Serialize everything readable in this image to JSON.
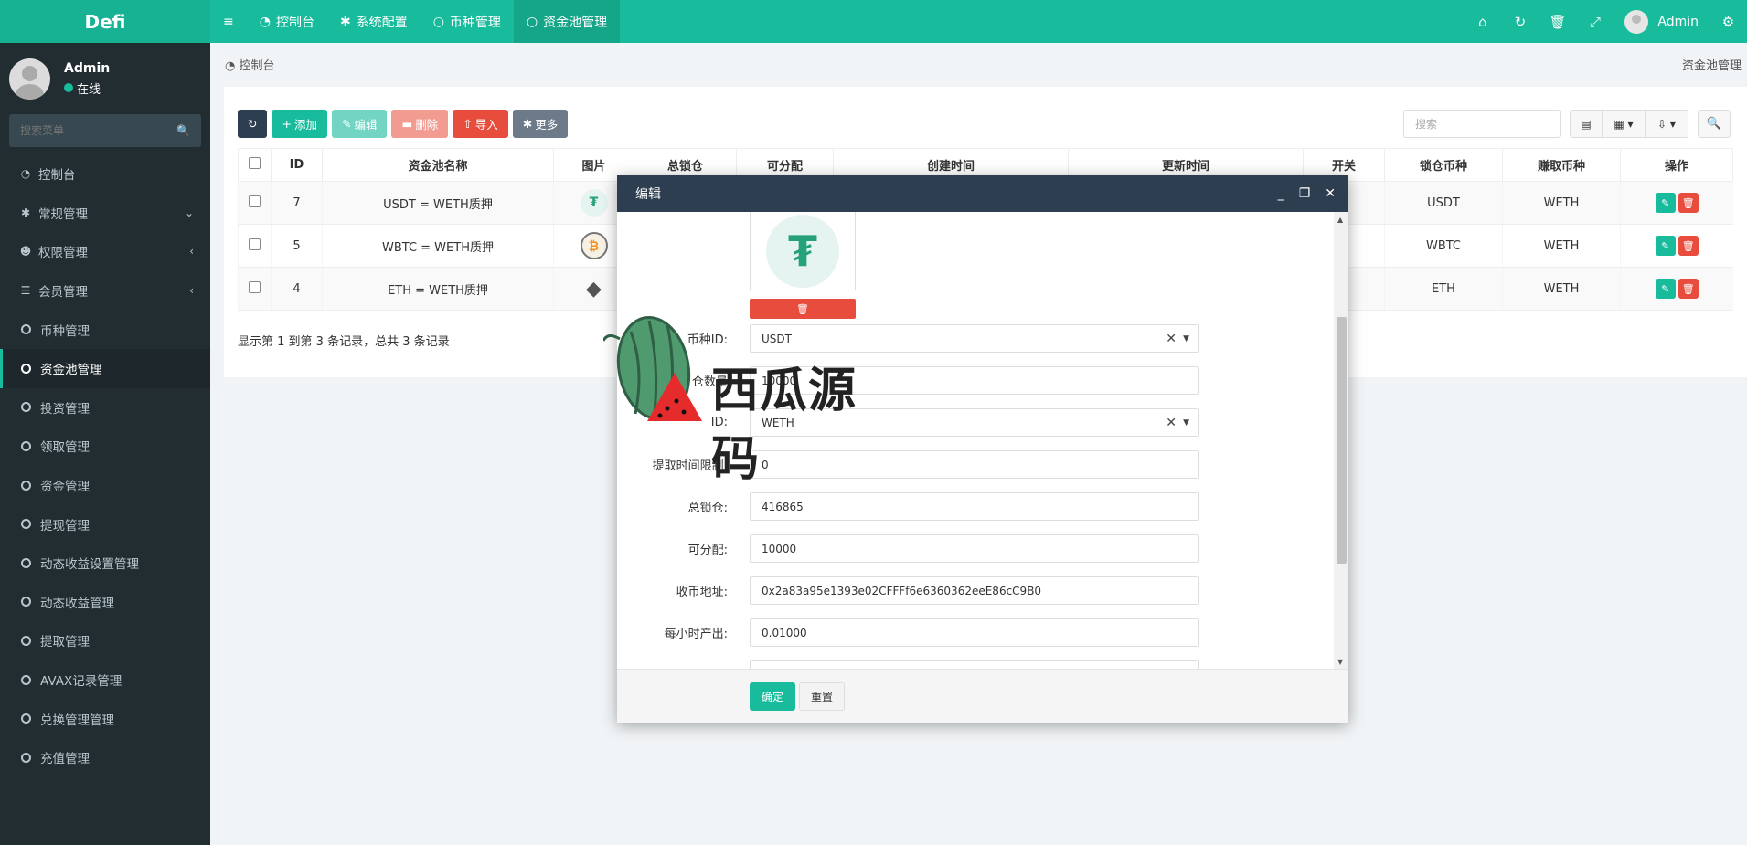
{
  "brand": "Defi",
  "top_tabs": [
    {
      "label": "控制台",
      "icon": "dashboard-icon"
    },
    {
      "label": "系统配置",
      "icon": "gear-icon"
    },
    {
      "label": "币种管理",
      "icon": "circle-icon"
    },
    {
      "label": "资金池管理",
      "icon": "circle-icon"
    }
  ],
  "top_user": "Admin",
  "user": {
    "name": "Admin",
    "status": "在线"
  },
  "sidebar_search_placeholder": "搜索菜单",
  "menu": [
    {
      "label": "控制台"
    },
    {
      "label": "常规管理"
    },
    {
      "label": "权限管理"
    },
    {
      "label": "会员管理"
    },
    {
      "label": "币种管理"
    },
    {
      "label": "资金池管理"
    },
    {
      "label": "投资管理"
    },
    {
      "label": "领取管理"
    },
    {
      "label": "资金管理"
    },
    {
      "label": "提现管理"
    },
    {
      "label": "动态收益设置管理"
    },
    {
      "label": "动态收益管理"
    },
    {
      "label": "提取管理"
    },
    {
      "label": "AVAX记录管理"
    },
    {
      "label": "兑换管理管理"
    },
    {
      "label": "充值管理"
    }
  ],
  "breadcrumb": "控制台",
  "page_title": "资金池管理",
  "toolbar": {
    "add": "添加",
    "edit": "编辑",
    "delete": "删除",
    "import": "导入",
    "more": "更多",
    "search_placeholder": "搜索"
  },
  "table": {
    "headers": [
      "ID",
      "资金池名称",
      "图片",
      "总锁仓",
      "可分配",
      "创建时间",
      "更新时间",
      "开关",
      "锁仓币种",
      "赚取币种",
      "操作"
    ],
    "rows": [
      {
        "id": "7",
        "name": "USDT = WETH质押",
        "coin": "USDT",
        "lock": "USDT",
        "earn": "WETH"
      },
      {
        "id": "5",
        "name": "WBTC = WETH质押",
        "coin": "WBTC",
        "lock": "WBTC",
        "earn": "WETH"
      },
      {
        "id": "4",
        "name": "ETH = WETH质押",
        "coin": "ETH",
        "lock": "ETH",
        "earn": "WETH"
      }
    ]
  },
  "page_info": "显示第 1 到第 3 条记录，总共 3 条记录",
  "modal": {
    "title": "编辑",
    "fields": [
      {
        "label": "币种ID:",
        "value": "USDT",
        "type": "select"
      },
      {
        "label": "仓数量",
        "value": "10000",
        "type": "text"
      },
      {
        "label": "ID:",
        "value": "WETH",
        "type": "select"
      },
      {
        "label": "提取时间限制:",
        "value": "0",
        "type": "text"
      },
      {
        "label": "总锁仓:",
        "value": "416865",
        "type": "text"
      },
      {
        "label": "可分配:",
        "value": "10000",
        "type": "text"
      },
      {
        "label": "收币地址:",
        "value": "0x2a83a95e1393e02CFFFf6e6360362eeE86cC9B0",
        "type": "text"
      },
      {
        "label": "每小时产出:",
        "value": "0.01000",
        "type": "text"
      }
    ],
    "ok": "确定",
    "reset": "重置"
  },
  "watermark": "西瓜源码",
  "colors": {
    "primary": "#18bc9c",
    "sidebar": "#222d32",
    "danger": "#e74c3c",
    "header": "#2c3e50"
  }
}
